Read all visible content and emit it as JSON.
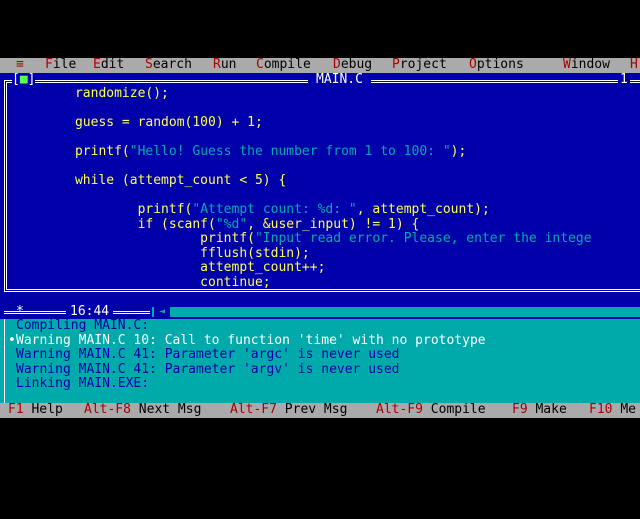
{
  "menu": {
    "system": "≡",
    "file": "File",
    "edit": "Edit",
    "search": "Search",
    "run": "Run",
    "compile": "Compile",
    "debug": "Debug",
    "project": "Project",
    "options": "Options",
    "window": "Window",
    "help": "H"
  },
  "editor": {
    "title": "MAIN.C",
    "close_box_left": "[",
    "close_box_mark": "■",
    "close_box_right": "]",
    "window_number": "1",
    "cursor_position": "16:44",
    "modified_mark": "*",
    "code": [
      "      randomize();",
      "",
      "      guess = random(100) + 1;",
      "",
      "      printf(\"Hello! Guess the number from 1 to 100: \");",
      "",
      "      while (attempt_count < 5) {",
      "",
      "              printf(\"Attempt count: %d: \", attempt_count);",
      "              if (scanf(\"%d\", &user_input) != 1) {",
      "                      printf(\"Input read error. Please, enter the intege",
      "                      fflush(stdin);",
      "                      attempt_count++;",
      "                      continue;"
    ]
  },
  "messages": {
    "selected_bullet": "•",
    "lines": [
      "Compiling MAIN.C:",
      "Warning MAIN.C 10: Call to function 'time' with no prototype",
      "Warning MAIN.C 41: Parameter 'argc' is never used",
      "Warning MAIN.C 41: Parameter 'argv' is never used",
      "Linking MAIN.EXE:"
    ]
  },
  "status": {
    "f1_key": "F1",
    "f1_label": "Help",
    "altf8_key": "Alt-F8",
    "altf8_label": "Next Msg",
    "altf7_key": "Alt-F7",
    "altf7_label": "Prev Msg",
    "altf9_key": "Alt-F9",
    "altf9_label": "Compile",
    "f9_key": "F9",
    "f9_label": "Make",
    "f10_key": "F10",
    "f10_label": "Me"
  },
  "colors": {
    "editor_bg": "#0000aa",
    "code_text": "#ffff55",
    "string_text": "#00aaaa",
    "message_bg": "#00aaaa",
    "menu_bg": "#aaaaaa",
    "hotkey": "#aa0000"
  }
}
